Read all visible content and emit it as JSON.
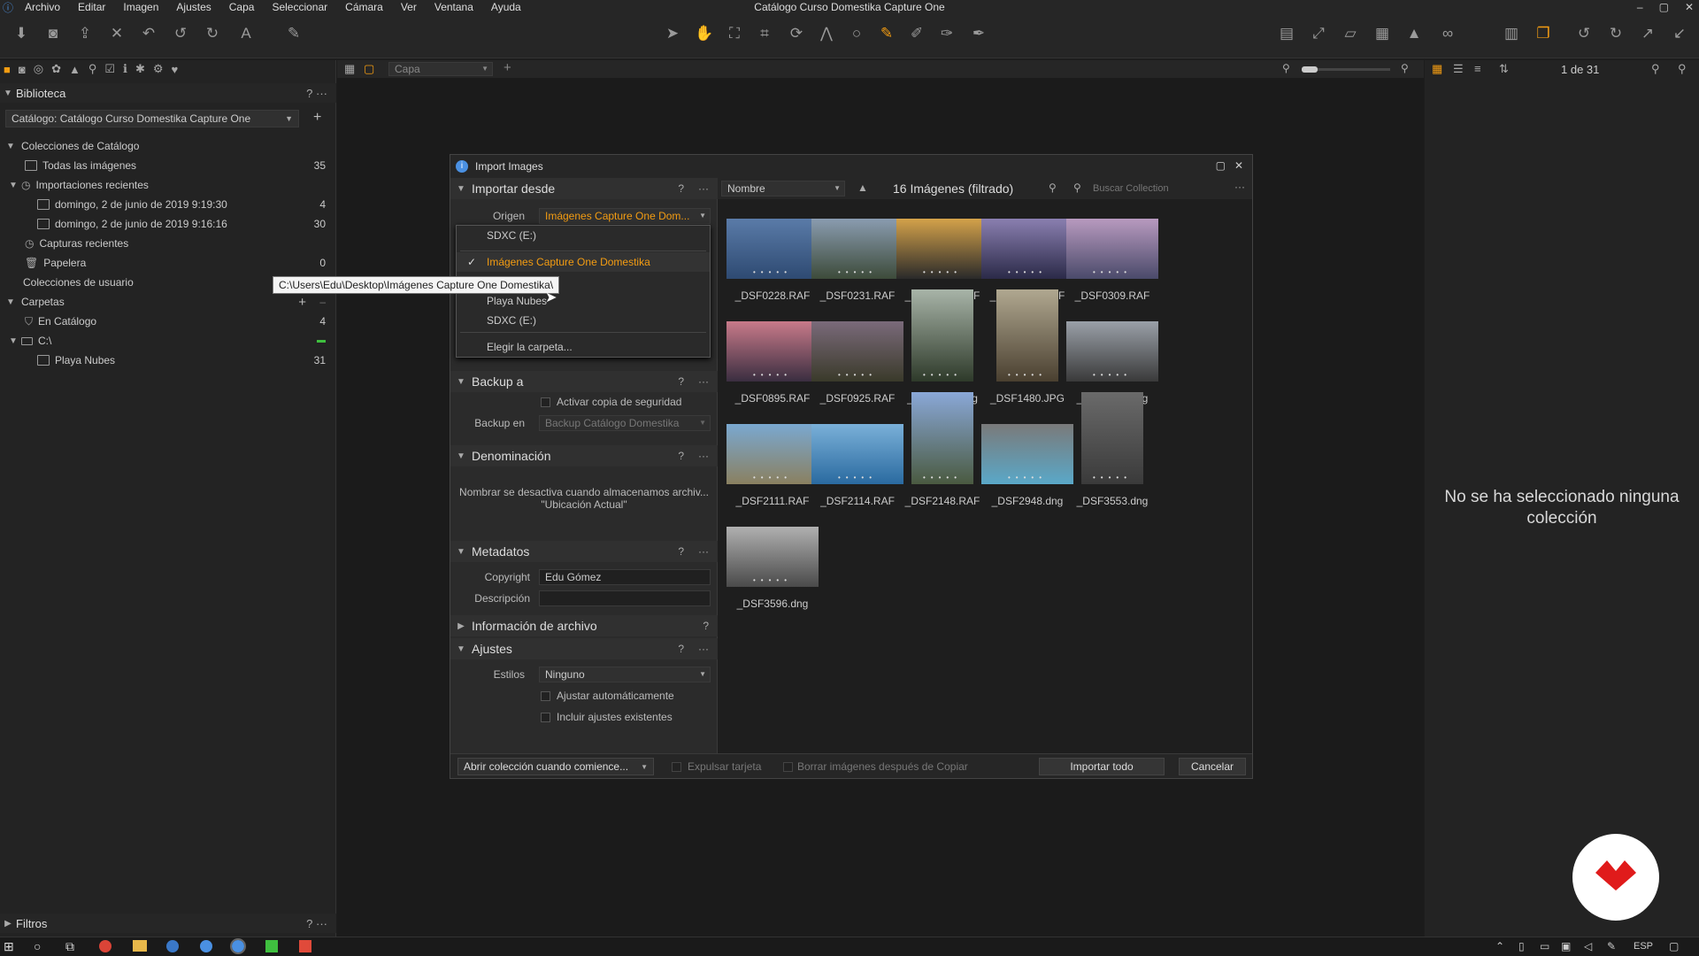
{
  "app": {
    "title": "Catálogo Curso Domestika Capture One",
    "menu": [
      "Archivo",
      "Editar",
      "Imagen",
      "Ajustes",
      "Capa",
      "Seleccionar",
      "Cámara",
      "Ver",
      "Ventana",
      "Ayuda"
    ],
    "window_controls": [
      "–",
      "▢",
      "✕"
    ]
  },
  "toolbar": {
    "layer_select": "Capa",
    "counter": "1 de 31"
  },
  "library": {
    "title": "Biblioteca",
    "catalog": "Catálogo: Catálogo Curso Domestika Capture One",
    "catalog_collections_label": "Colecciones de Catálogo",
    "items": [
      {
        "label": "Todas las imágenes",
        "count": "35"
      },
      {
        "label": "Importaciones recientes",
        "count": ""
      },
      {
        "label": "domingo, 2 de junio de 2019 9:19:30",
        "count": "4"
      },
      {
        "label": "domingo, 2 de junio de 2019 9:16:16",
        "count": "30"
      },
      {
        "label": "Capturas recientes",
        "count": ""
      },
      {
        "label": "Papelera",
        "count": "0"
      }
    ],
    "user_collections": "Colecciones de usuario",
    "folders_label": "Carpetas",
    "folders": [
      {
        "label": "En Catálogo",
        "count": "4"
      },
      {
        "label": "C:\\",
        "count": ""
      },
      {
        "label": "Playa Nubes",
        "count": "31"
      }
    ],
    "filters": "Filtros"
  },
  "right_panel": {
    "empty_message": "No se ha seleccionado ninguna colección"
  },
  "dialog": {
    "title": "Import Images",
    "import_from": {
      "header": "Importar desde",
      "origin_label": "Origen",
      "origin_value": "Imágenes Capture One Dom..."
    },
    "dropdown": {
      "items": [
        "SDXC (E:)",
        "Imágenes Capture One Domestika",
        "Playa Nubes",
        "SDXC (E:)",
        "Elegir la carpeta..."
      ],
      "selected_index": 1
    },
    "tooltip": "C:\\Users\\Edu\\Desktop\\Imágenes Capture One Domestika\\",
    "backup": {
      "header": "Backup a",
      "enable_label": "Activar copia de seguridad",
      "backup_in_label": "Backup en",
      "backup_in_value": "Backup Catálogo Domestika"
    },
    "naming": {
      "header": "Denominación",
      "note": "Nombrar se desactiva cuando almacenamos archiv...",
      "note2": "\"Ubicación Actual\""
    },
    "metadata": {
      "header": "Metadatos",
      "copyright_label": "Copyright",
      "copyright_value": "Edu Gómez",
      "description_label": "Descripción",
      "description_value": ""
    },
    "file_info": {
      "header": "Información de archivo"
    },
    "adjustments": {
      "header": "Ajustes",
      "styles_label": "Estilos",
      "styles_value": "Ninguno",
      "auto_adjust": "Ajustar automáticamente",
      "include_existing": "Incluir ajustes existentes"
    },
    "grid": {
      "sort": "Nombre",
      "count": "16 Imágenes (filtrado)",
      "search_placeholder": "Buscar Collection",
      "thumbs": [
        {
          "name": "_DSF0228.RAF",
          "c1": "#5a7ba8",
          "c2": "#2e4a72"
        },
        {
          "name": "_DSF0231.RAF",
          "c1": "#8a9cb0",
          "c2": "#3d4b3a"
        },
        {
          "name": "_DSF0295.RAF",
          "c1": "#d4a24a",
          "c2": "#2a2a2a"
        },
        {
          "name": "_DSF0308.RAF",
          "c1": "#8a7fb0",
          "c2": "#2b2a48"
        },
        {
          "name": "_DSF0309.RAF",
          "c1": "#b89abf",
          "c2": "#4a4a6a"
        },
        {
          "name": "_DSF0895.RAF",
          "c1": "#c87a8a",
          "c2": "#3a2e40"
        },
        {
          "name": "_DSF0925.RAF",
          "c1": "#7a6a7a",
          "c2": "#3a3a2a"
        },
        {
          "name": "_DSF1104.dng",
          "c1": "#a8b4a8",
          "c2": "#2e3a2a"
        },
        {
          "name": "_DSF1480.JPG",
          "c1": "#b0a890",
          "c2": "#4a4030"
        },
        {
          "name": "_DSF1617.dng",
          "c1": "#9aa0a8",
          "c2": "#3a3a3a"
        },
        {
          "name": "_DSF2111.RAF",
          "c1": "#7aa8d0",
          "c2": "#8a8060"
        },
        {
          "name": "_DSF2114.RAF",
          "c1": "#7ab0d8",
          "c2": "#2a6aa0"
        },
        {
          "name": "_DSF2148.RAF",
          "c1": "#8aa8d8",
          "c2": "#4a5a40"
        },
        {
          "name": "_DSF2948.dng",
          "c1": "#7a7a7a",
          "c2": "#5aa8c8"
        },
        {
          "name": "_DSF3553.dng",
          "c1": "#6a6a6a",
          "c2": "#3a3a3a"
        },
        {
          "name": "_DSF3596.dng",
          "c1": "#b0b0b0",
          "c2": "#4a4a4a"
        }
      ]
    },
    "bottom": {
      "open_collection": "Abrir colección cuando comience...",
      "eject_card": "Expulsar tarjeta",
      "delete_after": "Borrar imágenes después de Copiar",
      "import_all": "Importar todo",
      "cancel": "Cancelar"
    }
  },
  "taskbar": {
    "lang": "ESP"
  }
}
